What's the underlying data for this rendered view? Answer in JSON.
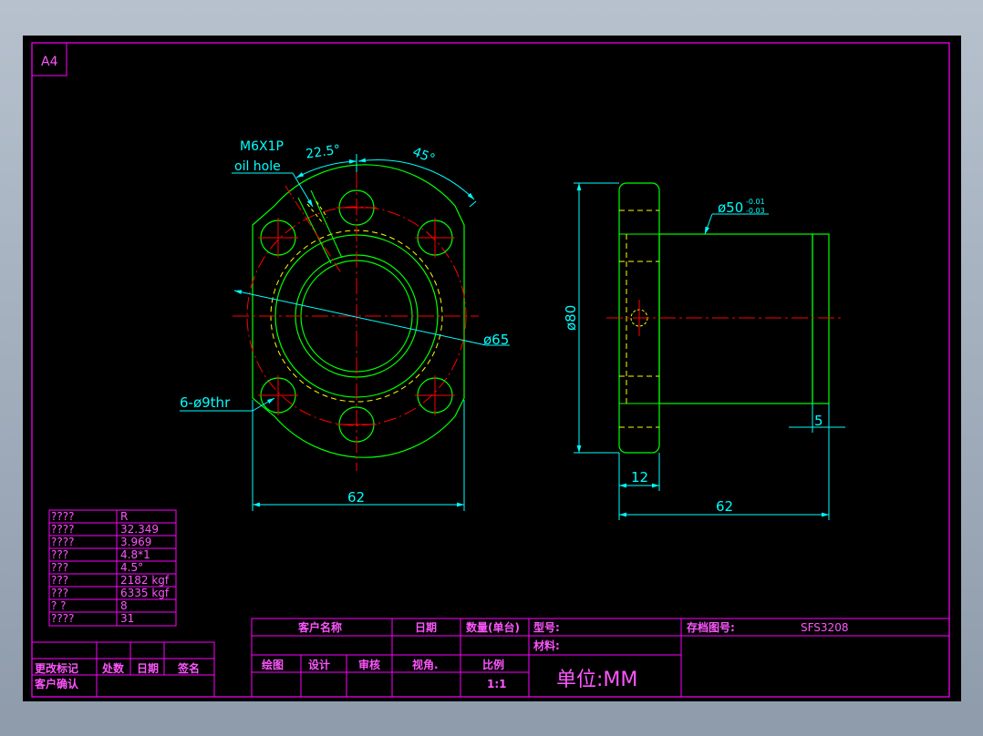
{
  "sheet": {
    "size_label": "A4"
  },
  "front_view": {
    "oil_hole_label_1": "M6X1P",
    "oil_hole_label_2": "oil hole",
    "angle_1": "22.5°",
    "angle_2": "45°",
    "dia_label": "ø65",
    "holes_label": "6-ø9thr",
    "width_label": "62"
  },
  "side_view": {
    "dia_outer": "ø80",
    "dia_shaft": "ø50",
    "tol_upper": "-0.01",
    "tol_lower": "-0.03",
    "flange_thickness": "12",
    "step_width": "5",
    "total_length": "62"
  },
  "param_table": {
    "rows": [
      {
        "label": "????",
        "value": "R"
      },
      {
        "label": "????",
        "value": "32.349"
      },
      {
        "label": "????",
        "value": "3.969"
      },
      {
        "label": " ???",
        "value": "4.8*1"
      },
      {
        "label": " ???",
        "value": "4.5°"
      },
      {
        "label": " ???",
        "value": "2182 kgf"
      },
      {
        "label": " ???",
        "value": "6335 kgf"
      },
      {
        "label": " ?  ?",
        "value": "8"
      },
      {
        "label": "????",
        "value": "31"
      }
    ]
  },
  "revision_block": {
    "change_mark": "更改标记",
    "place_count": "处数",
    "date": "日期",
    "signature": "签名",
    "customer_confirm": "客户确认"
  },
  "title_block": {
    "customer_name": "客户名称",
    "date": "日期",
    "quantity": "数量(单台)",
    "model": "型号:",
    "file_no_label": "存档图号:",
    "file_no": "SFS3208",
    "material": "材料:",
    "draw": "绘图",
    "design": "设计",
    "review": "审核",
    "view_angle": "视角.",
    "scale_label": "比例",
    "scale": "1:1",
    "unit": "单位:MM"
  },
  "colors": {
    "frame": "#ff00ff",
    "geometry": "#00ff00",
    "dimension": "#00ffff",
    "center_line": "#ff0000",
    "hidden_line": "#ffff00"
  }
}
